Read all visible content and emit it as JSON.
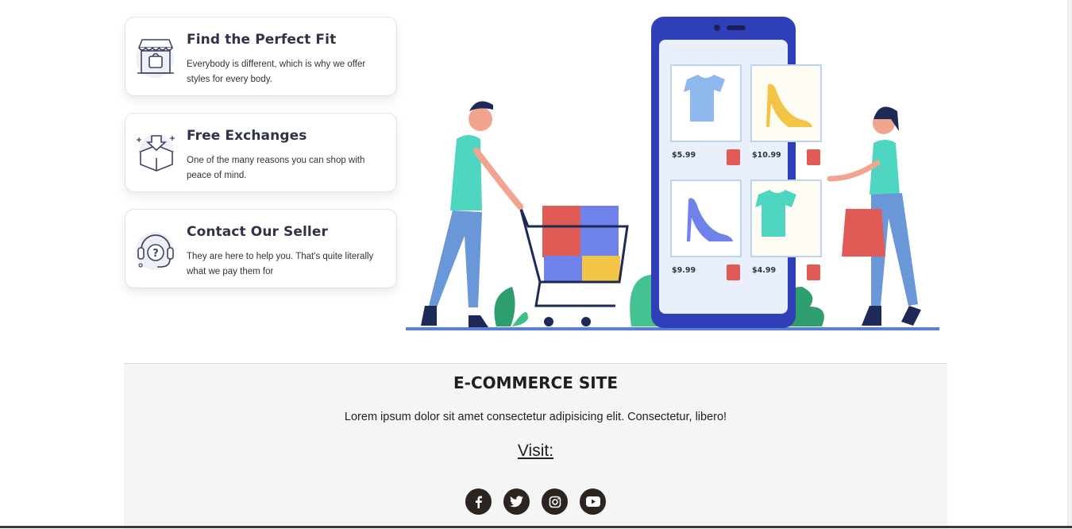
{
  "features": [
    {
      "icon": "store-icon",
      "title": "Find the Perfect Fit",
      "text": "Everybody is different, which is why we offer styles for every body."
    },
    {
      "icon": "box-icon",
      "title": "Free Exchanges",
      "text": "One of the many reasons you can shop with peace of mind."
    },
    {
      "icon": "headset-icon",
      "title": "Contact Our Seller",
      "text": "They are here to help you. That's quite literally what we pay them for"
    }
  ],
  "illustration": {
    "prices": [
      "$5.99",
      "$10.99",
      "$9.99",
      "$4.99"
    ]
  },
  "footer": {
    "brand": "E-COMMERCE SITE",
    "description": "Lorem ipsum dolor sit amet consectetur adipisicing elit. Consectetur, libero!",
    "visit": "Visit:",
    "social": [
      "facebook-icon",
      "twitter-icon",
      "instagram-icon",
      "youtube-icon"
    ]
  }
}
